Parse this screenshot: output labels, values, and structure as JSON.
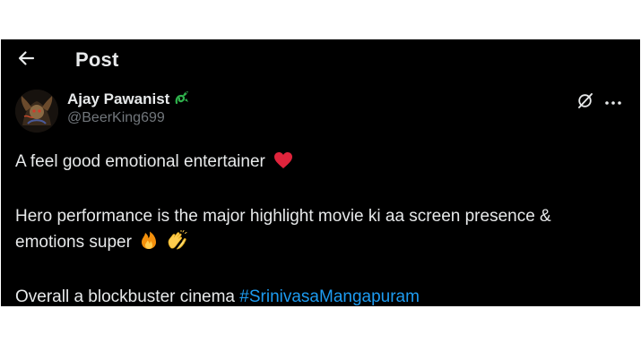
{
  "header": {
    "back_icon": "back-arrow-icon",
    "title": "Post"
  },
  "author": {
    "display_name": "Ajay Pawanist",
    "name_badge_icon": "green-dragon-icon",
    "handle": "@BeerKing699",
    "avatar_icon": "avatar-image"
  },
  "actions": {
    "grok_icon": "grok-icon",
    "more_icon": "more-options-icon"
  },
  "post": {
    "line1": "A feel good emotional entertainer",
    "line1_emoji": "red-heart-emoji",
    "line2": "Hero performance is the major highlight movie ki aa screen presence & emotions super",
    "line2_emojis": [
      "fire-emoji",
      "clapping-hands-emoji"
    ],
    "line3_text": "Overall a blockbuster cinema ",
    "line3_hashtag": "#SrinivasaMangapuram"
  },
  "colors": {
    "background": "#000000",
    "text_primary": "#e7e9ea",
    "text_secondary": "#71767b",
    "link": "#1d9bf0",
    "heart": "#f91880",
    "badge_green": "#2fb24c"
  }
}
